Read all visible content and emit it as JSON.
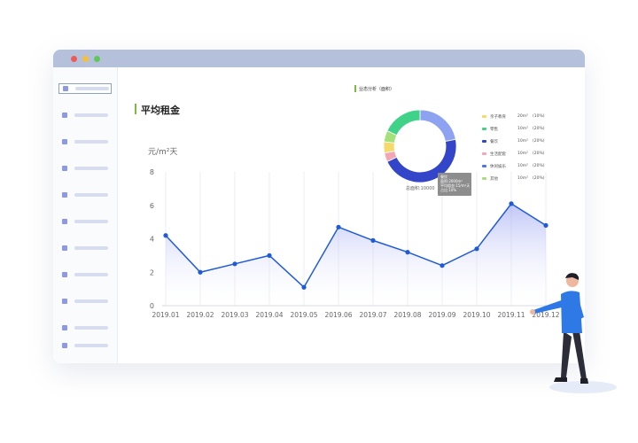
{
  "window": {
    "sidebar_items": [
      {
        "name": "nav-item-1"
      },
      {
        "name": "nav-item-2"
      },
      {
        "name": "nav-item-3"
      },
      {
        "name": "nav-item-4"
      },
      {
        "name": "nav-item-5"
      },
      {
        "name": "nav-item-6"
      },
      {
        "name": "nav-item-7"
      },
      {
        "name": "nav-item-8"
      },
      {
        "name": "nav-item-9"
      },
      {
        "name": "nav-item-10"
      },
      {
        "name": "nav-item-11"
      }
    ]
  },
  "main": {
    "heading": "平均租金",
    "unit_label": "元/m²天"
  },
  "donut": {
    "title": "业态分析（面积）",
    "total": "总面积:10000",
    "tooltip": [
      "餐饮",
      "面积:2000m²",
      "平均租金:15/m²天",
      "占比:10%"
    ],
    "legend": [
      {
        "name": "亲子教育",
        "value": "20m²",
        "percent": "(10%)",
        "color": "#f4d96b"
      },
      {
        "name": "零售",
        "value": "10m²",
        "percent": "(20%)",
        "color": "#41d28a"
      },
      {
        "name": "餐饮",
        "value": "10m²",
        "percent": "(20%)",
        "color": "#3346c9"
      },
      {
        "name": "生活配套",
        "value": "10m²",
        "percent": "(20%)",
        "color": "#f4a6b6"
      },
      {
        "name": "休闲娱乐",
        "value": "10m²",
        "percent": "(20%)",
        "color": "#4f74ef"
      },
      {
        "name": "其他",
        "value": "10m²",
        "percent": "(20%)",
        "color": "#a5e07a"
      }
    ]
  },
  "chart_data": [
    {
      "type": "area",
      "title": "平均租金",
      "ylabel": "元/m²天",
      "categories": [
        "2019.01",
        "2019.02",
        "2019.03",
        "2019.04",
        "2019.05",
        "2019.06",
        "2019.07",
        "2019.08",
        "2019.09",
        "2019.10",
        "2019.11",
        "2019.12"
      ],
      "values": [
        4.2,
        2.0,
        2.5,
        3.0,
        1.1,
        4.7,
        3.9,
        3.2,
        2.4,
        3.4,
        6.1,
        4.8
      ],
      "ylim": [
        0,
        8
      ],
      "yticks": [
        0,
        2,
        4,
        6,
        8
      ],
      "grid": "vertical",
      "line_color": "#1f5bd6"
    },
    {
      "type": "pie",
      "title": "业态分析（面积）",
      "categories": [
        "休闲娱乐",
        "餐饮",
        "生活配套",
        "亲子教育",
        "其他",
        "零售"
      ],
      "values": [
        22,
        46,
        4,
        5,
        5,
        18
      ],
      "colors": [
        "#8ea2f2",
        "#3346c9",
        "#f4a6b6",
        "#f4d96b",
        "#a5e07a",
        "#41d28a"
      ],
      "donut": true
    }
  ]
}
